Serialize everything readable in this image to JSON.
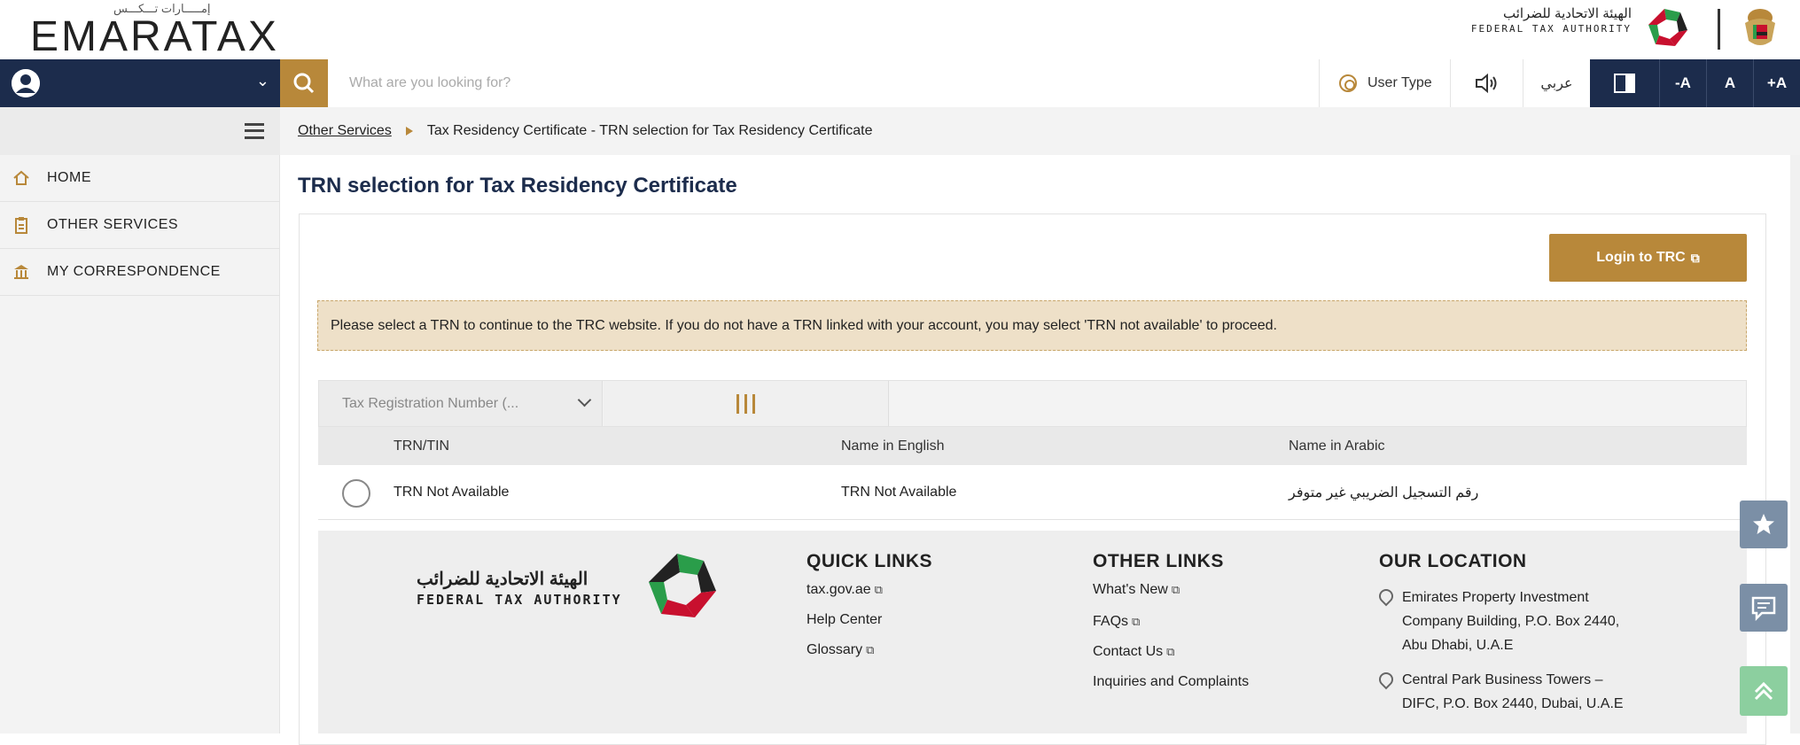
{
  "brand": {
    "logo_arabic": "إمـــــارات تـــكـــس",
    "logo_text": "EMARATAX",
    "fta_arabic": "الهيئة الاتحادية للضرائب",
    "fta_english": "FEDERAL TAX AUTHORITY"
  },
  "topnav": {
    "search_placeholder": "What are you looking for?",
    "user_type_label": "User Type",
    "language_label": "عربي",
    "font_decrease": "-A",
    "font_normal": "A",
    "font_increase": "+A"
  },
  "sidebar": {
    "items": [
      {
        "label": "HOME",
        "icon": "home-icon"
      },
      {
        "label": "OTHER SERVICES",
        "icon": "clipboard-icon"
      },
      {
        "label": "MY CORRESPONDENCE",
        "icon": "bank-icon"
      }
    ]
  },
  "breadcrumb": {
    "link": "Other Services",
    "current": "Tax Residency Certificate - TRN selection for Tax Residency Certificate"
  },
  "page": {
    "title": "TRN selection for Tax Residency Certificate",
    "login_button": "Login to TRC",
    "notice": "Please select a TRN to continue to the TRC website. If you do not have a TRN linked with your account, you may select 'TRN not available' to proceed."
  },
  "grid": {
    "column_selector": "Tax Registration Number (...",
    "headers": [
      "TRN/TIN",
      "Name in English",
      "Name in Arabic"
    ],
    "rows": [
      {
        "trn": "TRN Not Available",
        "name_en": "TRN Not Available",
        "name_ar": "رقم التسجيل الضريبي غير متوفر"
      }
    ]
  },
  "footer": {
    "fta_arabic": "الهيئة الاتحادية للضرائب",
    "fta_english": "FEDERAL TAX AUTHORITY",
    "quick_links": {
      "title": "QUICK LINKS",
      "items": [
        "tax.gov.ae",
        "Help Center",
        "Glossary"
      ]
    },
    "other_links": {
      "title": "OTHER LINKS",
      "items": [
        "What's New",
        "FAQs",
        "Contact Us",
        "Inquiries and Complaints"
      ]
    },
    "location": {
      "title": "OUR LOCATION",
      "address1_line1": "Emirates Property Investment",
      "address1_line2": "Company Building, P.O. Box 2440,",
      "address1_line3": "Abu Dhabi, U.A.E",
      "address2_line1": "Central Park Business Towers –",
      "address2_line2": "DIFC, P.O. Box 2440, Dubai, U.A.E"
    }
  },
  "colors": {
    "navy": "#1c2c4c",
    "gold": "#b8883a",
    "notice_bg": "#eee0c8",
    "float_blue": "#7b8fa6",
    "float_green": "#8ccf9f"
  }
}
